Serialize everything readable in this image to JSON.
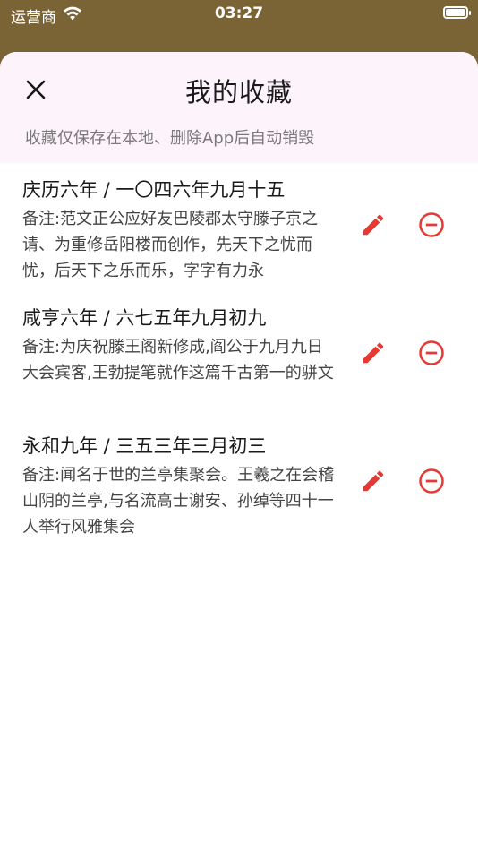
{
  "status_bar": {
    "carrier": "运营商",
    "time": "03:27",
    "wifi_icon": "wifi-icon",
    "battery_icon": "battery-icon"
  },
  "sheet": {
    "title": "我的收藏",
    "subtitle": "收藏仅保存在本地、删除App后自动销毁",
    "close_icon": "close-icon"
  },
  "colors": {
    "accent": "#e53935",
    "header_bg": "#fdf3fb",
    "backdrop": "#7a6334"
  },
  "favorites": [
    {
      "title": "庆历六年 / 一〇四六年九月十五",
      "note": "备注:范文正公应好友巴陵郡太守滕子京之请、为重修岳阳楼而创作，先天下之忧而忧，后天下之乐而乐，字字有力永",
      "edit_icon": "pencil-icon",
      "delete_icon": "minus-circle-icon"
    },
    {
      "title": "咸亨六年 / 六七五年九月初九",
      "note": "备注:为庆祝滕王阁新修成,阎公于九月九日大会宾客,王勃提笔就作这篇千古第一的骈文",
      "edit_icon": "pencil-icon",
      "delete_icon": "minus-circle-icon"
    },
    {
      "title": "永和九年 / 三五三年三月初三",
      "note": "备注:闻名于世的兰亭集聚会。王羲之在会稽山阴的兰亭,与名流高士谢安、孙绰等四十一人举行风雅集会",
      "edit_icon": "pencil-icon",
      "delete_icon": "minus-circle-icon"
    }
  ]
}
